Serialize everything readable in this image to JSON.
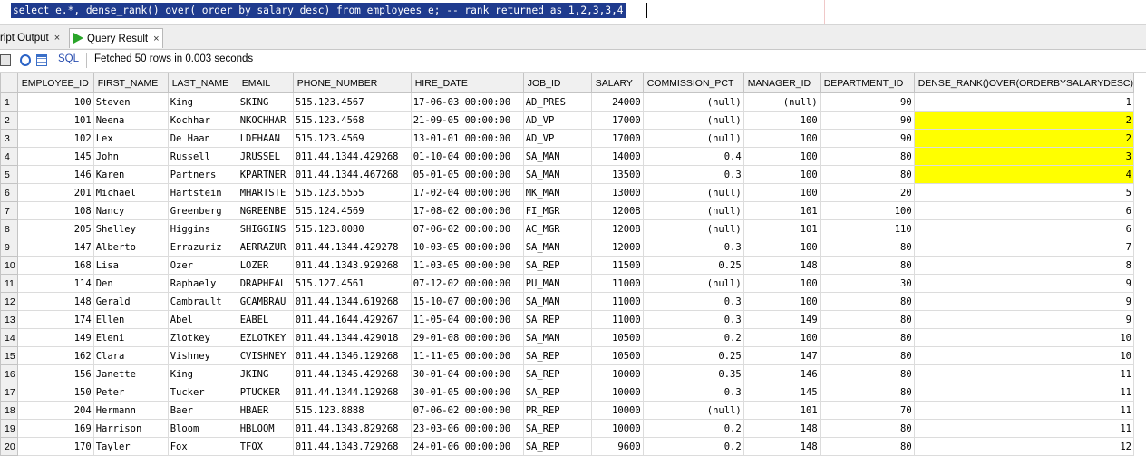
{
  "editor": {
    "sql": "select e.*, dense_rank() over( order by salary desc) from employees e; -- rank returned as 1,2,3,3,4"
  },
  "tabs": {
    "script_output": "ript Output",
    "query_result": "Query Result",
    "close_glyph": "×"
  },
  "toolbar": {
    "sql_label": "SQL",
    "status": "Fetched 50 rows in 0.003 seconds"
  },
  "grid": {
    "columns": [
      "EMPLOYEE_ID",
      "FIRST_NAME",
      "LAST_NAME",
      "EMAIL",
      "PHONE_NUMBER",
      "HIRE_DATE",
      "JOB_ID",
      "SALARY",
      "COMMISSION_PCT",
      "MANAGER_ID",
      "DEPARTMENT_ID",
      "DENSE_RANK()OVER(ORDERBYSALARYDESC)"
    ],
    "highlight_color": "#ffff00",
    "highlighted_rank_rows": [
      2,
      3,
      4,
      5
    ],
    "rows": [
      [
        "1",
        "100",
        "Steven",
        "King",
        "SKING",
        "515.123.4567",
        "17-06-03 00:00:00",
        "AD_PRES",
        "24000",
        "(null)",
        "(null)",
        "90",
        "1"
      ],
      [
        "2",
        "101",
        "Neena",
        "Kochhar",
        "NKOCHHAR",
        "515.123.4568",
        "21-09-05 00:00:00",
        "AD_VP",
        "17000",
        "(null)",
        "100",
        "90",
        "2"
      ],
      [
        "3",
        "102",
        "Lex",
        "De Haan",
        "LDEHAAN",
        "515.123.4569",
        "13-01-01 00:00:00",
        "AD_VP",
        "17000",
        "(null)",
        "100",
        "90",
        "2"
      ],
      [
        "4",
        "145",
        "John",
        "Russell",
        "JRUSSEL",
        "011.44.1344.429268",
        "01-10-04 00:00:00",
        "SA_MAN",
        "14000",
        "0.4",
        "100",
        "80",
        "3"
      ],
      [
        "5",
        "146",
        "Karen",
        "Partners",
        "KPARTNER",
        "011.44.1344.467268",
        "05-01-05 00:00:00",
        "SA_MAN",
        "13500",
        "0.3",
        "100",
        "80",
        "4"
      ],
      [
        "6",
        "201",
        "Michael",
        "Hartstein",
        "MHARTSTE",
        "515.123.5555",
        "17-02-04 00:00:00",
        "MK_MAN",
        "13000",
        "(null)",
        "100",
        "20",
        "5"
      ],
      [
        "7",
        "108",
        "Nancy",
        "Greenberg",
        "NGREENBE",
        "515.124.4569",
        "17-08-02 00:00:00",
        "FI_MGR",
        "12008",
        "(null)",
        "101",
        "100",
        "6"
      ],
      [
        "8",
        "205",
        "Shelley",
        "Higgins",
        "SHIGGINS",
        "515.123.8080",
        "07-06-02 00:00:00",
        "AC_MGR",
        "12008",
        "(null)",
        "101",
        "110",
        "6"
      ],
      [
        "9",
        "147",
        "Alberto",
        "Errazuriz",
        "AERRAZUR",
        "011.44.1344.429278",
        "10-03-05 00:00:00",
        "SA_MAN",
        "12000",
        "0.3",
        "100",
        "80",
        "7"
      ],
      [
        "10",
        "168",
        "Lisa",
        "Ozer",
        "LOZER",
        "011.44.1343.929268",
        "11-03-05 00:00:00",
        "SA_REP",
        "11500",
        "0.25",
        "148",
        "80",
        "8"
      ],
      [
        "11",
        "114",
        "Den",
        "Raphaely",
        "DRAPHEAL",
        "515.127.4561",
        "07-12-02 00:00:00",
        "PU_MAN",
        "11000",
        "(null)",
        "100",
        "30",
        "9"
      ],
      [
        "12",
        "148",
        "Gerald",
        "Cambrault",
        "GCAMBRAU",
        "011.44.1344.619268",
        "15-10-07 00:00:00",
        "SA_MAN",
        "11000",
        "0.3",
        "100",
        "80",
        "9"
      ],
      [
        "13",
        "174",
        "Ellen",
        "Abel",
        "EABEL",
        "011.44.1644.429267",
        "11-05-04 00:00:00",
        "SA_REP",
        "11000",
        "0.3",
        "149",
        "80",
        "9"
      ],
      [
        "14",
        "149",
        "Eleni",
        "Zlotkey",
        "EZLOTKEY",
        "011.44.1344.429018",
        "29-01-08 00:00:00",
        "SA_MAN",
        "10500",
        "0.2",
        "100",
        "80",
        "10"
      ],
      [
        "15",
        "162",
        "Clara",
        "Vishney",
        "CVISHNEY",
        "011.44.1346.129268",
        "11-11-05 00:00:00",
        "SA_REP",
        "10500",
        "0.25",
        "147",
        "80",
        "10"
      ],
      [
        "16",
        "156",
        "Janette",
        "King",
        "JKING",
        "011.44.1345.429268",
        "30-01-04 00:00:00",
        "SA_REP",
        "10000",
        "0.35",
        "146",
        "80",
        "11"
      ],
      [
        "17",
        "150",
        "Peter",
        "Tucker",
        "PTUCKER",
        "011.44.1344.129268",
        "30-01-05 00:00:00",
        "SA_REP",
        "10000",
        "0.3",
        "145",
        "80",
        "11"
      ],
      [
        "18",
        "204",
        "Hermann",
        "Baer",
        "HBAER",
        "515.123.8888",
        "07-06-02 00:00:00",
        "PR_REP",
        "10000",
        "(null)",
        "101",
        "70",
        "11"
      ],
      [
        "19",
        "169",
        "Harrison",
        "Bloom",
        "HBLOOM",
        "011.44.1343.829268",
        "23-03-06 00:00:00",
        "SA_REP",
        "10000",
        "0.2",
        "148",
        "80",
        "11"
      ],
      [
        "20",
        "170",
        "Tayler",
        "Fox",
        "TFOX",
        "011.44.1343.729268",
        "24-01-06 00:00:00",
        "SA_REP",
        "9600",
        "0.2",
        "148",
        "80",
        "12"
      ]
    ]
  }
}
